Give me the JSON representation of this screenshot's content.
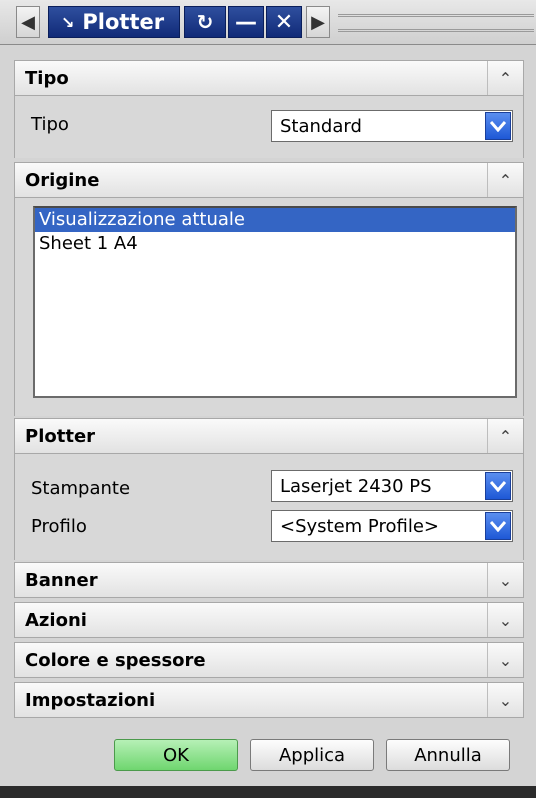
{
  "window": {
    "title": "Plotter",
    "nav_left_icon": "chevron-left-icon",
    "nav_right_icon": "chevron-right-icon",
    "title_icon": "arrow-icon",
    "reset_icon": "reset-icon",
    "minimize_icon": "minimize-icon",
    "close_icon": "close-icon"
  },
  "sections": {
    "tipo": {
      "header": "Tipo",
      "expanded": true,
      "fields": {
        "tipo_label": "Tipo",
        "tipo_value": "Standard"
      }
    },
    "origine": {
      "header": "Origine",
      "expanded": true,
      "items": [
        "Visualizzazione attuale",
        "Sheet 1  A4"
      ],
      "selected_index": 0
    },
    "plotter": {
      "header": "Plotter",
      "expanded": true,
      "fields": {
        "stampante_label": "Stampante",
        "stampante_value": "Laserjet 2430 PS",
        "profilo_label": "Profilo",
        "profilo_value": "<System Profile>"
      }
    },
    "banner": {
      "header": "Banner",
      "expanded": false
    },
    "azioni": {
      "header": "Azioni",
      "expanded": false
    },
    "colore": {
      "header": "Colore e spessore",
      "expanded": false
    },
    "impostazioni": {
      "header": "Impostazioni",
      "expanded": false
    }
  },
  "buttons": {
    "ok": "OK",
    "applica": "Applica",
    "annulla": "Annulla"
  },
  "colors": {
    "accent": "#1e58d6",
    "selection": "#3465c4",
    "ok_button": "#6fd66f",
    "title_bar": "#102a78"
  }
}
